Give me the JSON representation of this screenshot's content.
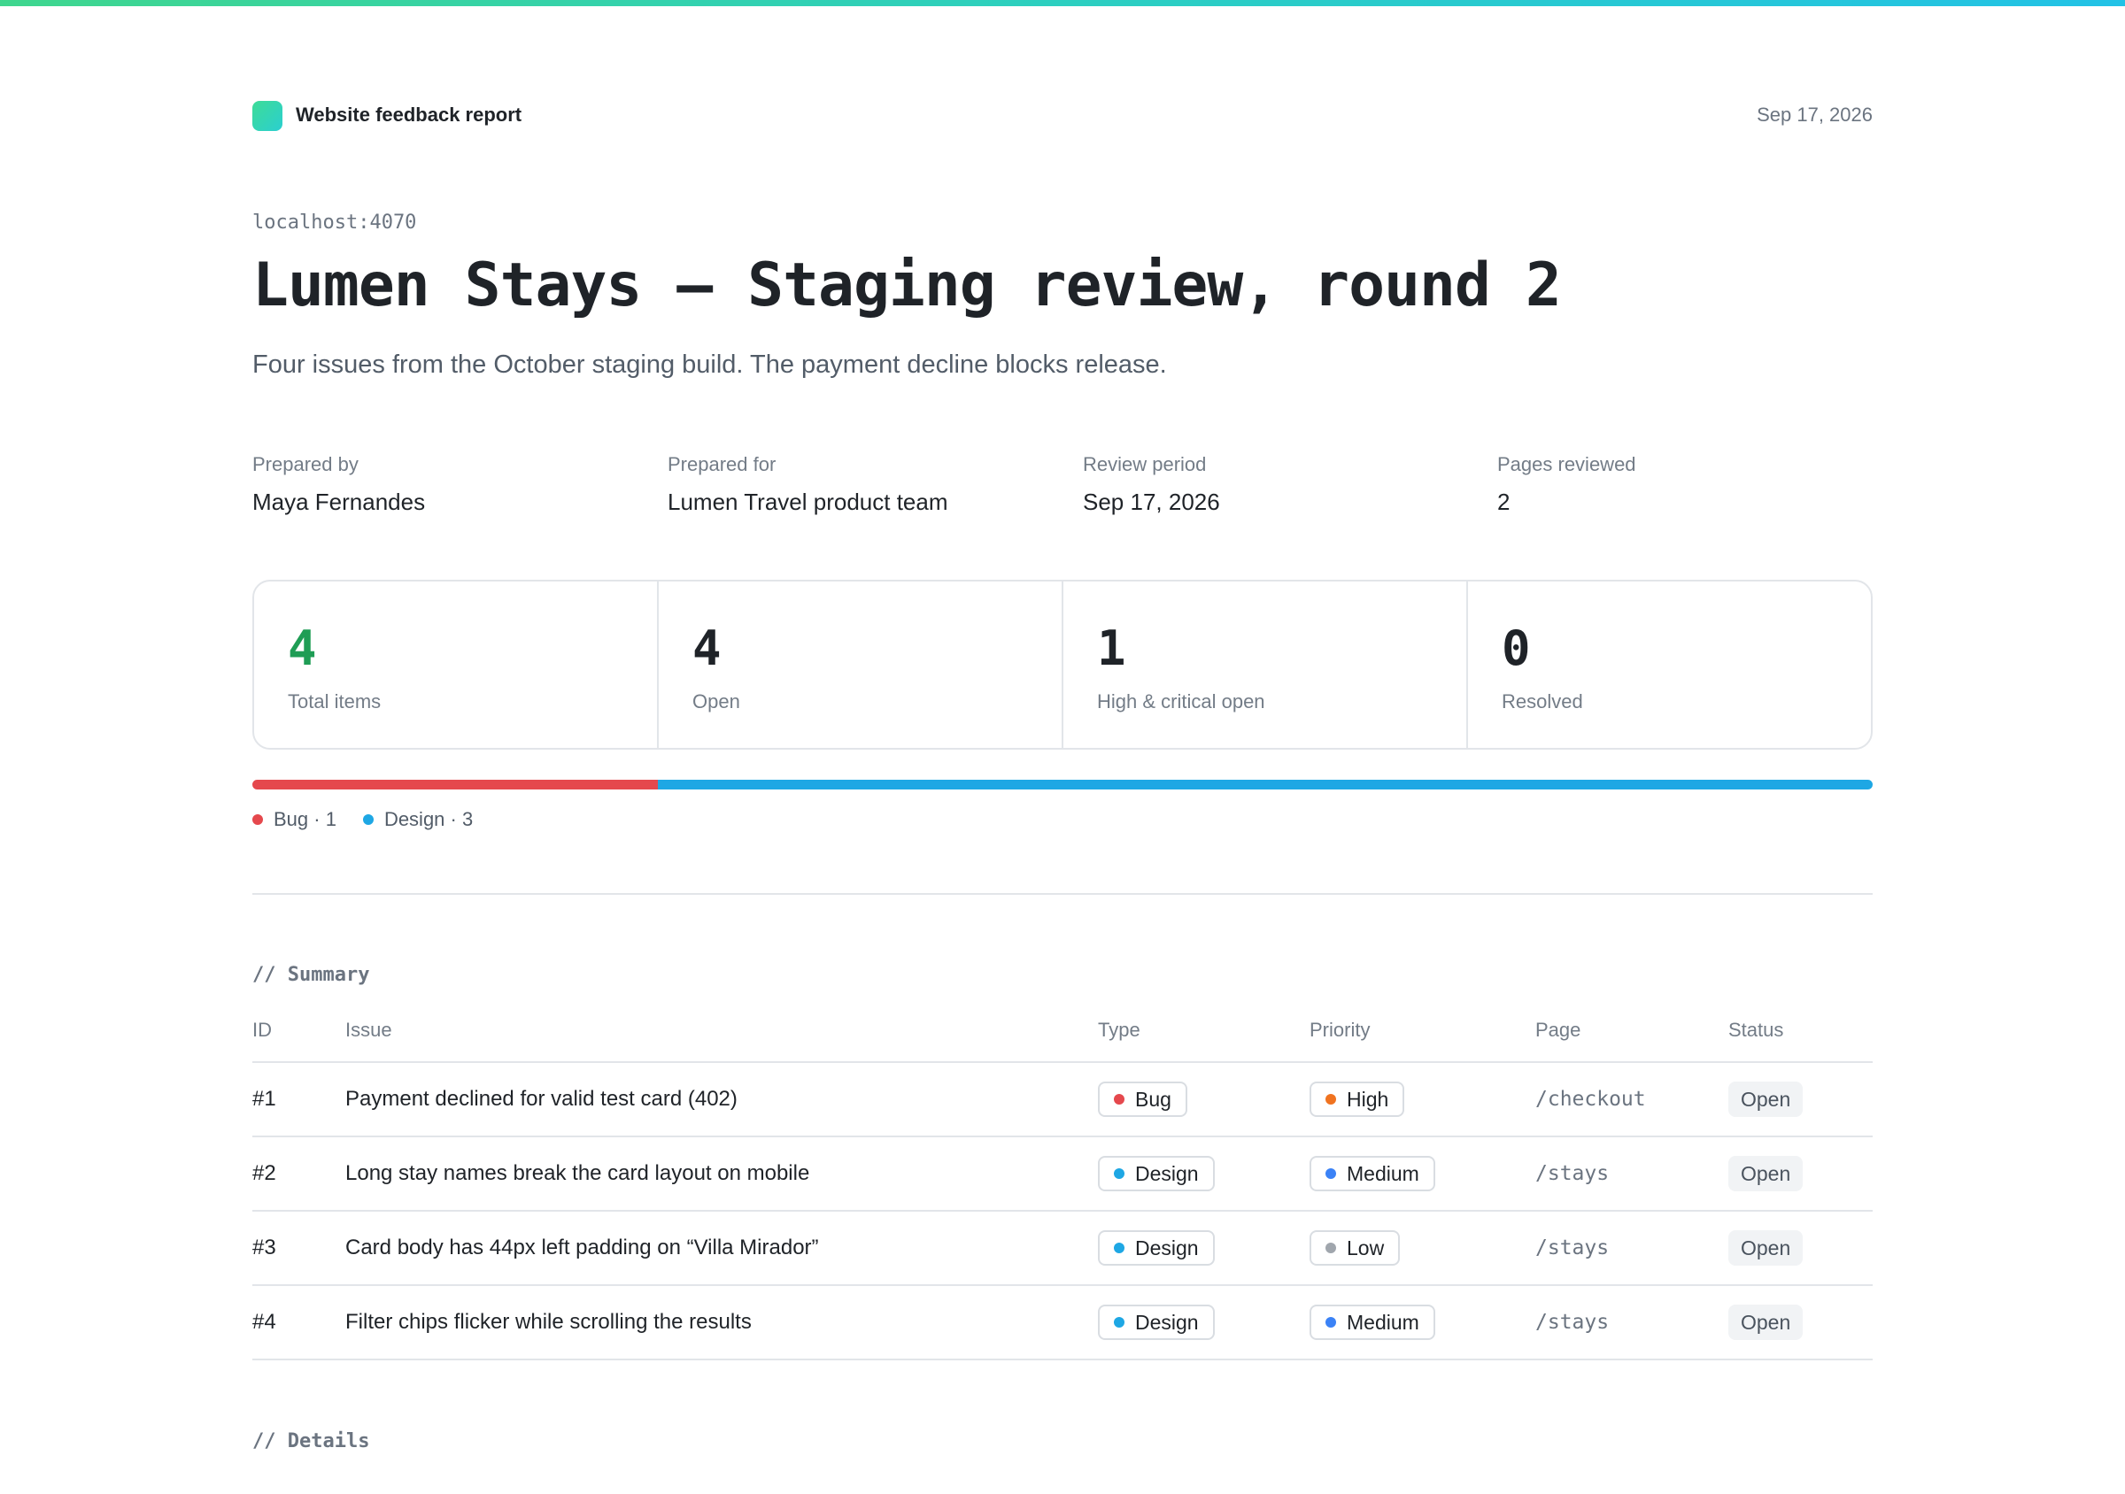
{
  "header": {
    "brand_title": "Website feedback report",
    "date": "Sep 17, 2026"
  },
  "report": {
    "host": "localhost:4070",
    "title": "Lumen Stays — Staging review, round 2",
    "subtitle": "Four issues from the October staging build. The payment decline blocks release."
  },
  "meta": [
    {
      "label": "Prepared by",
      "value": "Maya Fernandes"
    },
    {
      "label": "Prepared for",
      "value": "Lumen Travel product team"
    },
    {
      "label": "Review period",
      "value": "Sep 17, 2026"
    },
    {
      "label": "Pages reviewed",
      "value": "2"
    }
  ],
  "stats": [
    {
      "value": "4",
      "label": "Total items"
    },
    {
      "value": "4",
      "label": "Open"
    },
    {
      "value": "1",
      "label": "High & critical open"
    },
    {
      "value": "0",
      "label": "Resolved"
    }
  ],
  "distribution": [
    {
      "label": "Bug · 1",
      "count": 1,
      "color": "#e5484d"
    },
    {
      "label": "Design · 3",
      "count": 3,
      "color": "#1ea7e4"
    }
  ],
  "sections": {
    "summary": "// Summary",
    "details": "// Details"
  },
  "table": {
    "headers": [
      "ID",
      "Issue",
      "Type",
      "Priority",
      "Page",
      "Status"
    ],
    "rows": [
      {
        "id": "#1",
        "issue": "Payment declined for valid test card (402)",
        "type": "Bug",
        "type_color": "#e5484d",
        "priority": "High",
        "priority_color": "#f07320",
        "page": "/checkout",
        "status": "Open"
      },
      {
        "id": "#2",
        "issue": "Long stay names break the card layout on mobile",
        "type": "Design",
        "type_color": "#1ea7e4",
        "priority": "Medium",
        "priority_color": "#3b82f6",
        "page": "/stays",
        "status": "Open"
      },
      {
        "id": "#3",
        "issue": "Card body has 44px left padding on “Villa Mirador”",
        "type": "Design",
        "type_color": "#1ea7e4",
        "priority": "Low",
        "priority_color": "#a0a6ad",
        "page": "/stays",
        "status": "Open"
      },
      {
        "id": "#4",
        "issue": "Filter chips flicker while scrolling the results",
        "type": "Design",
        "type_color": "#1ea7e4",
        "priority": "Medium",
        "priority_color": "#3b82f6",
        "page": "/stays",
        "status": "Open"
      }
    ]
  }
}
